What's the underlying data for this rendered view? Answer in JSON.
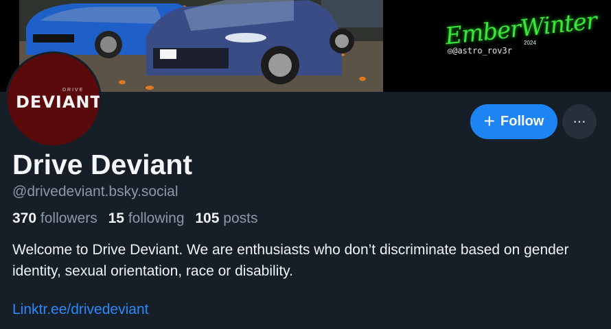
{
  "banner": {
    "signature": "EmberWinter",
    "year": "2024",
    "handle": "@astro_rov3r"
  },
  "avatar": {
    "small_text": "DRIVE",
    "big_text": "DEVIANT"
  },
  "actions": {
    "follow_label": "Follow",
    "more_label": "···"
  },
  "profile": {
    "display_name": "Drive Deviant",
    "handle": "@drivedeviant.bsky.social",
    "followers_count": "370",
    "followers_label": "followers",
    "following_count": "15",
    "following_label": "following",
    "posts_count": "105",
    "posts_label": "posts",
    "bio": "Welcome to Drive Deviant. We are enthusiasts who don’t discriminate based on gender identity, sexual orientation, race or disability.",
    "link": "Linktr.ee/drivedeviant"
  },
  "colors": {
    "background": "#161e27",
    "accent": "#1d84f4",
    "muted_text": "#8d99a6",
    "link": "#2b8af7"
  }
}
